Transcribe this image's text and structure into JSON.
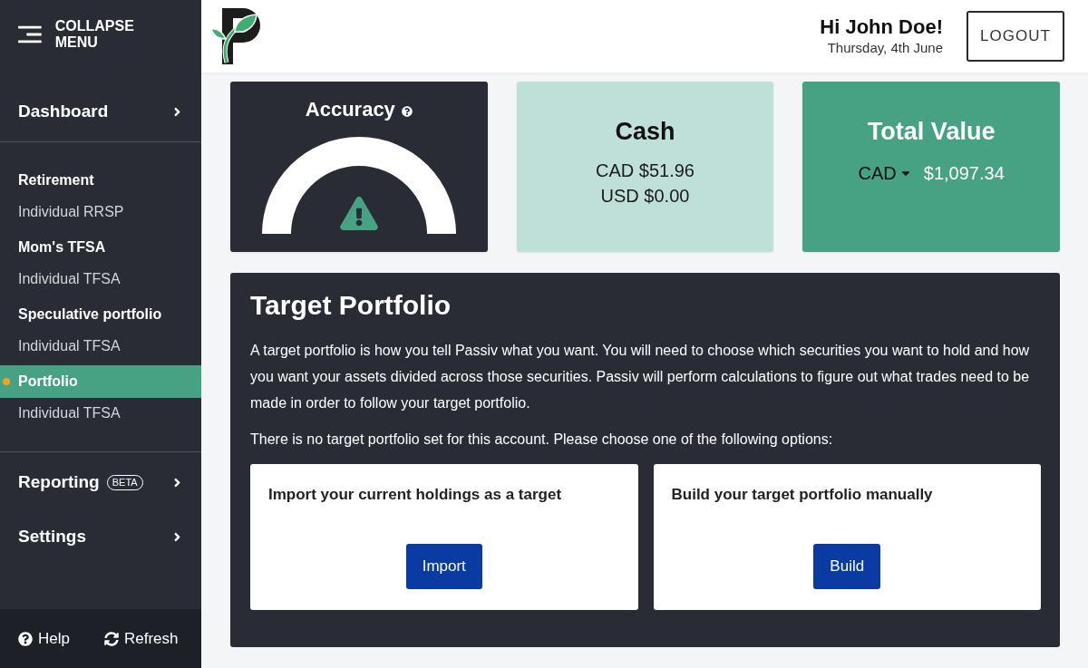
{
  "sidebar": {
    "collapse_label": "COLLAPSE MENU",
    "top_nav": [
      {
        "label": "Dashboard"
      }
    ],
    "accounts": [
      {
        "name": "Retirement",
        "type": "Individual RRSP",
        "selected": false
      },
      {
        "name": "Mom's TFSA",
        "type": "Individual TFSA",
        "selected": false
      },
      {
        "name": "Speculative portfolio",
        "type": "Individual TFSA",
        "selected": false
      },
      {
        "name": "Portfolio",
        "type": "Individual TFSA",
        "selected": true
      }
    ],
    "bottom_nav": [
      {
        "label": "Reporting",
        "badge": "BETA"
      },
      {
        "label": "Settings"
      }
    ],
    "footer": [
      {
        "label": "Help",
        "kind": "help"
      },
      {
        "label": "Refresh",
        "kind": "refresh"
      }
    ]
  },
  "header": {
    "greeting": "Hi John Doe!",
    "date": "Thursday, 4th June",
    "logout": "LOGOUT"
  },
  "cards": [
    {
      "kind": "accuracy",
      "title": "Accuracy"
    },
    {
      "kind": "cash",
      "title": "Cash",
      "lines": [
        "CAD $51.96",
        "USD $0.00"
      ]
    },
    {
      "kind": "total",
      "title": "Total Value",
      "currency": "CAD",
      "amount": "$1,097.34"
    }
  ],
  "target_portfolio": {
    "title": "Target Portfolio",
    "paragraphs": [
      "A target portfolio is how you tell Passiv what you want. You will need to choose which securities you want to hold and how you want your assets divided across those securities. Passiv will perform calculations to figure out what trades need to be made in order to follow your target portfolio.",
      "There is no target portfolio set for this account. Please choose one of the following options:"
    ],
    "options": [
      {
        "text": "Import your current holdings as a target",
        "button": "Import"
      },
      {
        "text": "Build your target portfolio manually",
        "button": "Build"
      }
    ]
  }
}
